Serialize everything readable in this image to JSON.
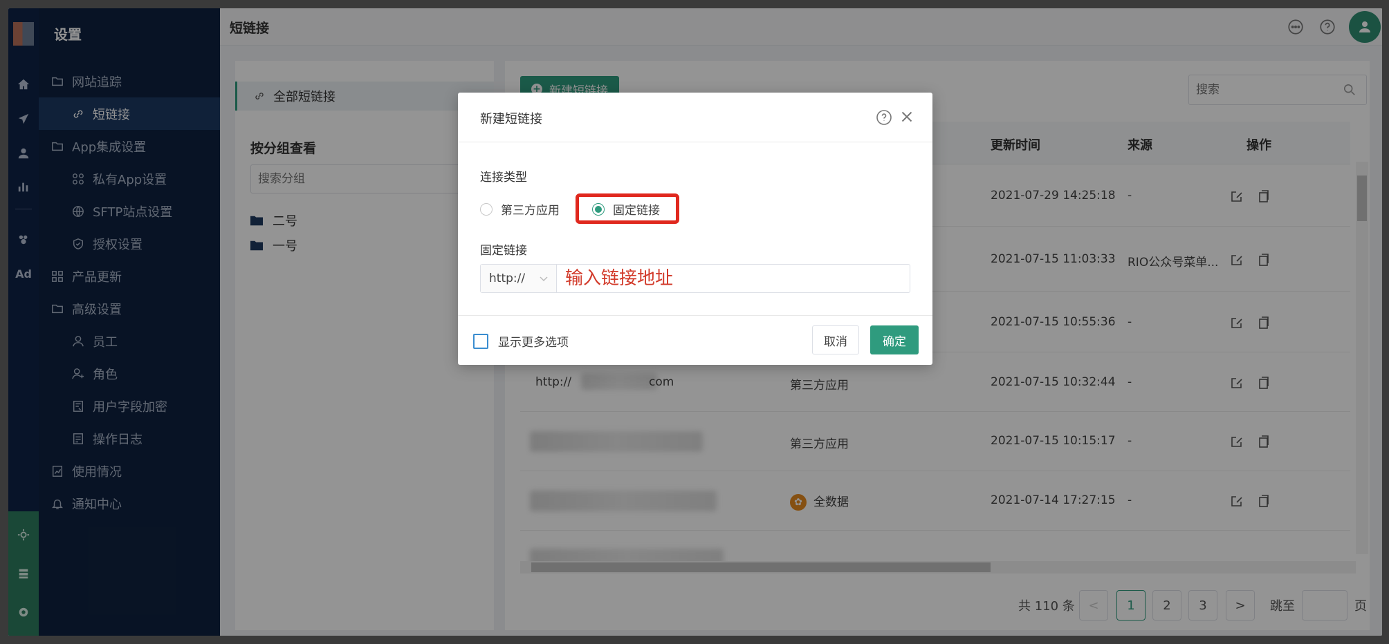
{
  "sidebar": {
    "title": "设置",
    "items": [
      {
        "label": "网站追踪",
        "icon": "folder-icon"
      },
      {
        "label": "短链接",
        "icon": "link-icon"
      },
      {
        "label": "App集成设置",
        "icon": "folder-icon"
      },
      {
        "label": "私有App设置",
        "icon": "grid-cmd-icon"
      },
      {
        "label": "SFTP站点设置",
        "icon": "globe-icon"
      },
      {
        "label": "授权设置",
        "icon": "shield-icon"
      },
      {
        "label": "产品更新",
        "icon": "apps-icon"
      },
      {
        "label": "高级设置",
        "icon": "folder-icon"
      },
      {
        "label": "员工",
        "icon": "user-icon"
      },
      {
        "label": "角色",
        "icon": "role-icon"
      },
      {
        "label": "用户字段加密",
        "icon": "encrypt-icon"
      },
      {
        "label": "操作日志",
        "icon": "log-icon"
      },
      {
        "label": "使用情况",
        "icon": "usage-icon"
      },
      {
        "label": "通知中心",
        "icon": "bell-icon"
      }
    ]
  },
  "rail": {
    "ad_label": "Ad"
  },
  "header": {
    "title": "短链接"
  },
  "groups": {
    "all_label": "全部短链接",
    "title": "按分组查看",
    "search_placeholder": "搜索分组",
    "folders": [
      "二号",
      "一号"
    ]
  },
  "main": {
    "new_button": "新建短链接",
    "search_placeholder": "搜索",
    "columns": {
      "updated": "更新时间",
      "source": "来源",
      "actions": "操作"
    },
    "rows": [
      {
        "url": "",
        "type": "",
        "updated": "2021-07-29 14:25:18",
        "source": "-"
      },
      {
        "url": "",
        "type": "",
        "updated": "2021-07-15 11:03:33",
        "source": "RIO公众号菜单..."
      },
      {
        "url": "",
        "type": "",
        "updated": "2021-07-15 10:55:36",
        "source": "-"
      },
      {
        "url": "http://",
        "url_tail": "com",
        "type": "第三方应用",
        "updated": "2021-07-15 10:32:44",
        "source": "-"
      },
      {
        "url": "",
        "type": "第三方应用",
        "updated": "2021-07-15 10:15:17",
        "source": "-"
      },
      {
        "url": "",
        "type": "全数据",
        "updated": "2021-07-14 17:27:15",
        "source": "-"
      }
    ],
    "pagination": {
      "total": "共 110 条",
      "pages": [
        "1",
        "2",
        "3"
      ],
      "prev": "<",
      "next": ">",
      "jump_label": "跳至",
      "page_unit": "页"
    }
  },
  "modal": {
    "title": "新建短链接",
    "link_type_label": "连接类型",
    "options": [
      "第三方应用",
      "固定链接"
    ],
    "selected_option": "固定链接",
    "fixed_link_label": "固定链接",
    "protocol": "http://",
    "url_placeholder": "输入链接地址",
    "more_options": "显示更多选项",
    "cancel": "取消",
    "confirm": "确定"
  },
  "colors": {
    "accent": "#2f9b7e",
    "sidebar": "#0f2240",
    "highlight": "#e0281e"
  }
}
